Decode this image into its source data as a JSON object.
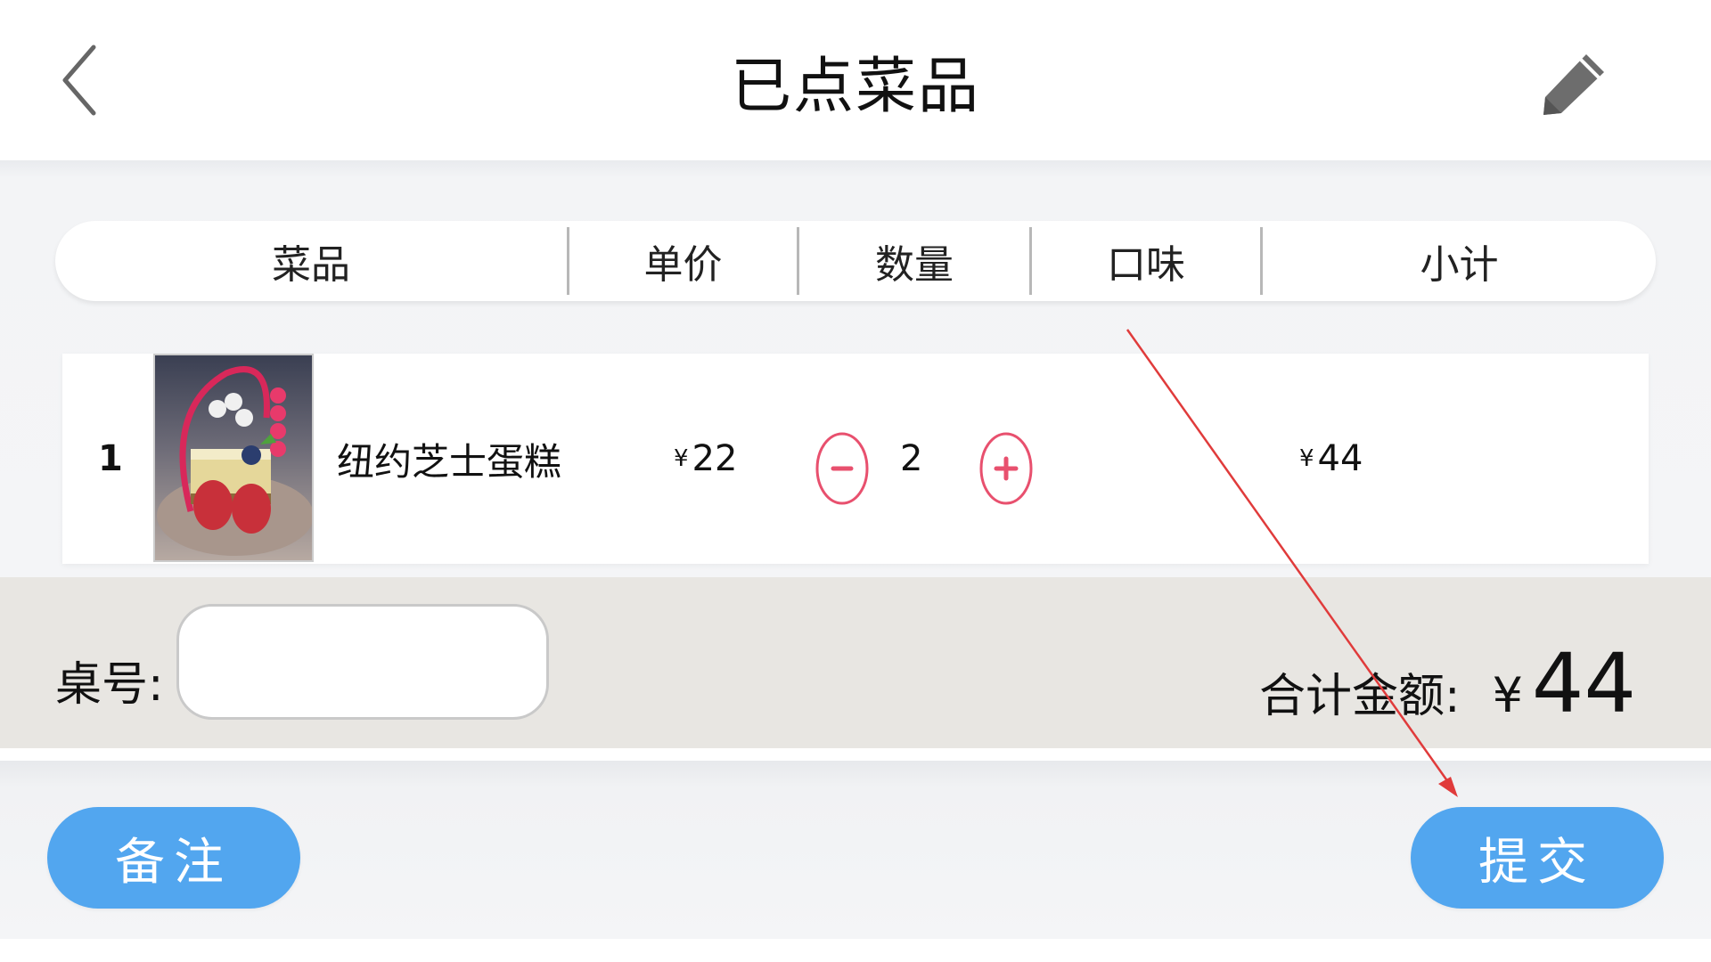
{
  "header": {
    "title": "已点菜品"
  },
  "columns": [
    "菜品",
    "单价",
    "数量",
    "口味",
    "小计"
  ],
  "order_items": [
    {
      "index": "1",
      "name": "纽约芝士蛋糕",
      "unit_price_symbol": "¥",
      "unit_price": "22",
      "quantity": "2",
      "flavor": "",
      "subtotal_symbol": "¥",
      "subtotal": "44"
    }
  ],
  "summary": {
    "table_label": "桌号:",
    "table_value": "",
    "total_label": "合计金额:",
    "total_symbol": "¥",
    "total_value": "44"
  },
  "actions": {
    "note_label": "备注",
    "submit_label": "提交"
  },
  "colors": {
    "accent_blue": "#52a6ef",
    "stepper_red": "#e8506e",
    "summary_bg": "#e8e6e2",
    "annotation_red": "#e03b3b"
  }
}
